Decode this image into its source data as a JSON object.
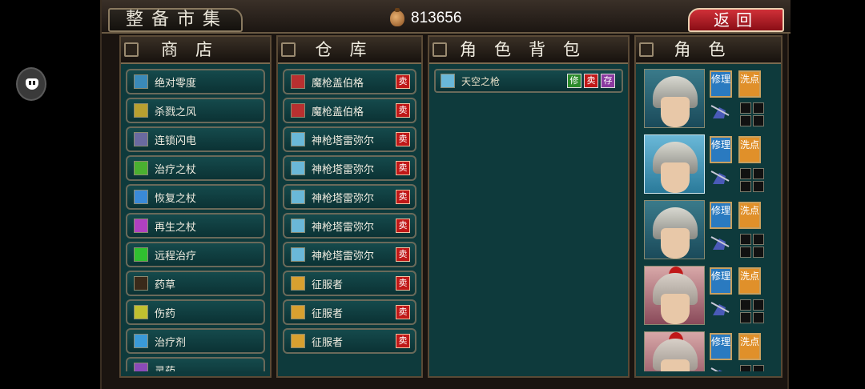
{
  "header": {
    "title": "整备市集",
    "gold": "813656",
    "back_label": "返回"
  },
  "panels": {
    "shop": "商店",
    "warehouse": "仓库",
    "bag": "角色背包",
    "role": "角色"
  },
  "shop_items": [
    {
      "label": "绝对零度",
      "icon": "ice-skill-icon",
      "color": "#3a8ab8"
    },
    {
      "label": "杀戮之风",
      "icon": "wind-skill-icon",
      "color": "#b8a030"
    },
    {
      "label": "连锁闪电",
      "icon": "lightning-skill-icon",
      "color": "#6a6aa0"
    },
    {
      "label": "治疗之杖",
      "icon": "staff-icon",
      "color": "#4ab030"
    },
    {
      "label": "恢复之杖",
      "icon": "staff-icon",
      "color": "#3a8ad8"
    },
    {
      "label": "再生之杖",
      "icon": "staff-icon",
      "color": "#b040c0"
    },
    {
      "label": "远程治疗",
      "icon": "cross-icon",
      "color": "#30c030"
    },
    {
      "label": "药草",
      "icon": "herb-icon",
      "color": "#3a2a1a"
    },
    {
      "label": "伤药",
      "icon": "potion-icon",
      "color": "#c0c030"
    },
    {
      "label": "治疗剂",
      "icon": "potion-icon",
      "color": "#3a9ad8"
    },
    {
      "label": "灵药",
      "icon": "elixir-icon",
      "color": "#8a4ab8"
    }
  ],
  "warehouse_items": [
    {
      "label": "魔枪盖伯格",
      "icon": "lance-icon",
      "color": "#b83030"
    },
    {
      "label": "魔枪盖伯格",
      "icon": "lance-icon",
      "color": "#b83030"
    },
    {
      "label": "神枪塔雷弥尔",
      "icon": "spear-icon",
      "color": "#6ab8d8"
    },
    {
      "label": "神枪塔雷弥尔",
      "icon": "spear-icon",
      "color": "#6ab8d8"
    },
    {
      "label": "神枪塔雷弥尔",
      "icon": "spear-icon",
      "color": "#6ab8d8"
    },
    {
      "label": "神枪塔雷弥尔",
      "icon": "spear-icon",
      "color": "#6ab8d8"
    },
    {
      "label": "神枪塔雷弥尔",
      "icon": "spear-icon",
      "color": "#6ab8d8"
    },
    {
      "label": "征服者",
      "icon": "axe-icon",
      "color": "#d8a030"
    },
    {
      "label": "征服者",
      "icon": "axe-icon",
      "color": "#d8a030"
    },
    {
      "label": "征服者",
      "icon": "axe-icon",
      "color": "#d8a030"
    }
  ],
  "sell_label": "卖",
  "bag_items": [
    {
      "label": "天空之枪",
      "fix": "修",
      "sell": "卖",
      "store": "存"
    }
  ],
  "role_buttons": {
    "fix": "修理",
    "wash": "洗点"
  },
  "roles": [
    {
      "portrait": "helmet-soldier",
      "variant": ""
    },
    {
      "portrait": "helmet-soldier",
      "variant": "sel"
    },
    {
      "portrait": "helmet-soldier",
      "variant": ""
    },
    {
      "portrait": "red-plume-knight",
      "variant": "red"
    },
    {
      "portrait": "red-plume-knight",
      "variant": "red"
    }
  ]
}
